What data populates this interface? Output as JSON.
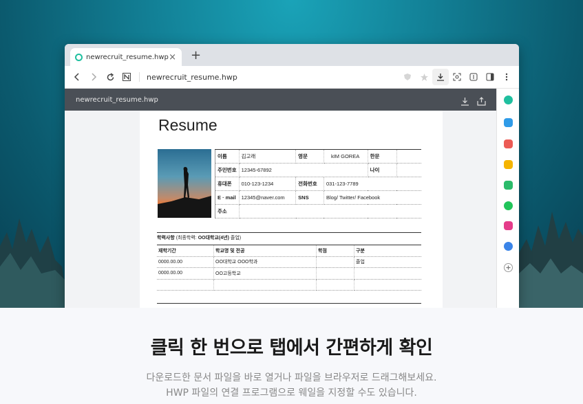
{
  "browser": {
    "tab_title": "newrecruit_resume.hwp",
    "tab_close": "×",
    "new_tab": "+",
    "url": "newrecruit_resume.hwp"
  },
  "viewer": {
    "file_name": "newrecruit_resume.hwp"
  },
  "resume": {
    "title": "Resume",
    "info_rows": [
      [
        "이름",
        "김고래",
        "영문",
        "kIM  GOREA",
        "한문",
        ""
      ],
      [
        "주민번호",
        "12345-67892",
        "",
        "",
        "나이",
        ""
      ],
      [
        "휴대폰",
        "010-123-1234",
        "전화번호",
        "031-123-7789",
        "",
        ""
      ],
      [
        "E  ·  mail",
        "12345@naver.com",
        "SNS",
        "Blog/  Twitter/  Facebook",
        "",
        ""
      ],
      [
        "주소",
        "",
        "",
        "",
        "",
        ""
      ]
    ],
    "education": {
      "title": "학력사항",
      "note": "(최종학력:",
      "note_bold": "OO대학교(4년)",
      "note_end": "졸업)",
      "headers": [
        "재학기간",
        "학교명  및  전공",
        "학점",
        "구분"
      ],
      "rows": [
        [
          "0000.00.00",
          "OO대학교  OOO학과",
          "",
          "졸업"
        ],
        [
          "0000.00.00",
          "OO고등학교",
          "",
          ""
        ],
        [
          "",
          "",
          "",
          ""
        ]
      ]
    }
  },
  "bottom": {
    "headline": "클릭 한 번으로 탭에서 간편하게 확인",
    "line1": "다운로드한 문서 파일을 바로 열거나 파일을 브라우저로 드래그해보세요.",
    "line2": "HWP 파일의 연결 프로그램으로 웨일을 지정할 수도 있습니다."
  },
  "colors": {
    "accent": "#1fbf9f",
    "viewer_bar": "#4a4f56"
  }
}
